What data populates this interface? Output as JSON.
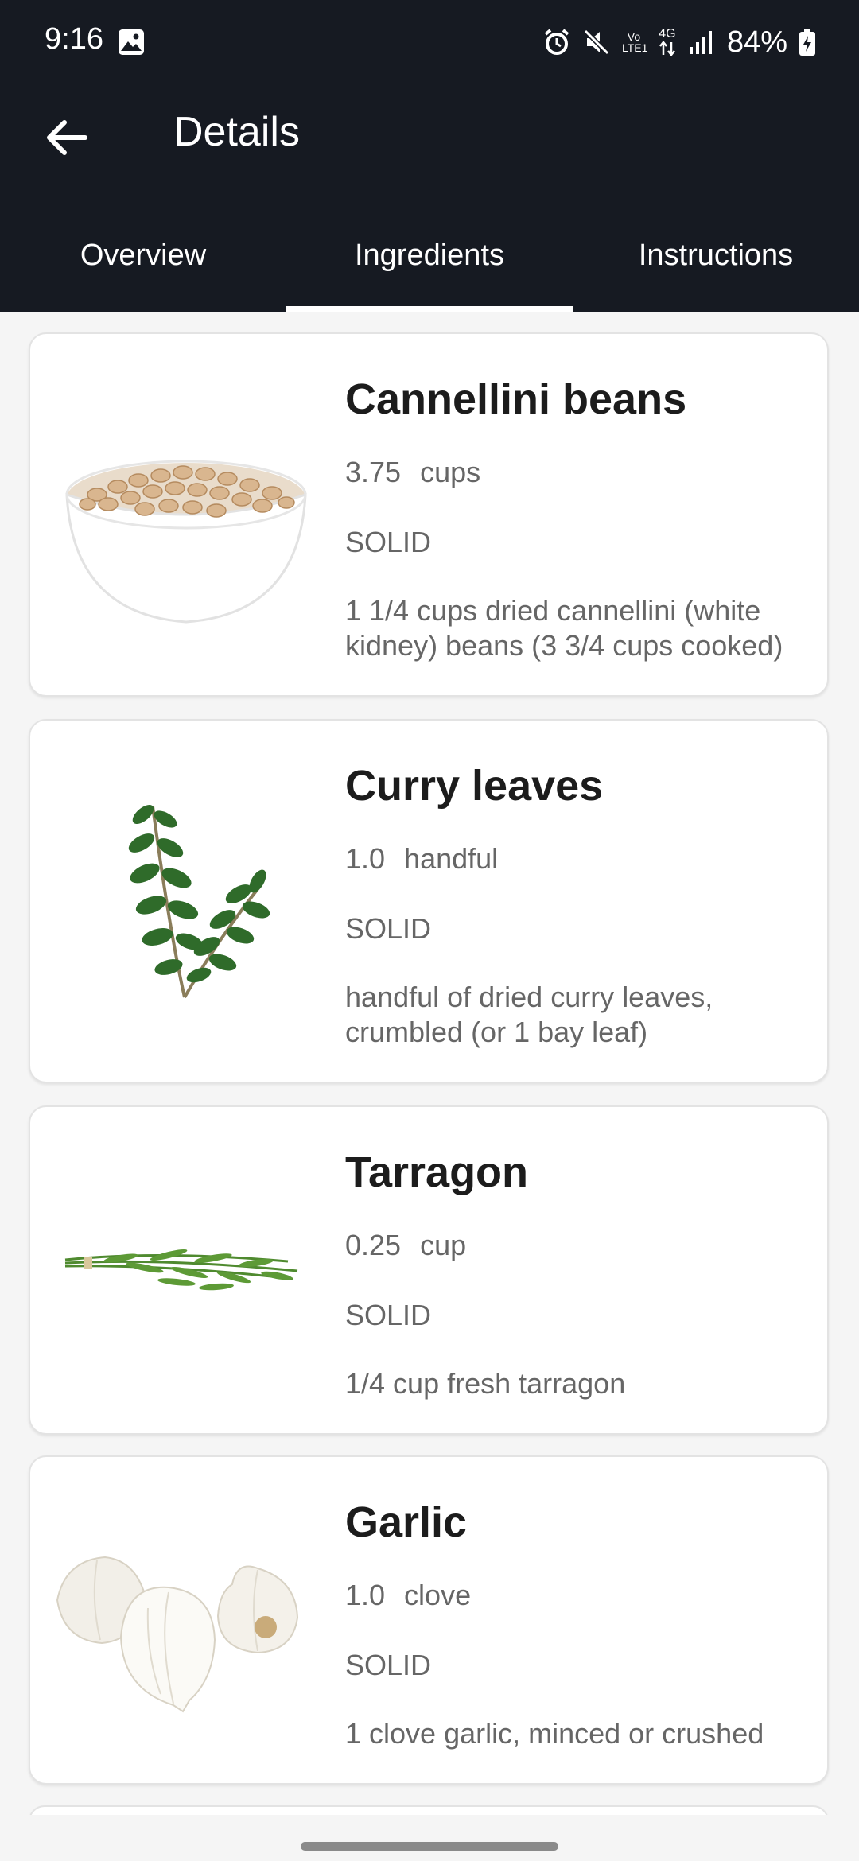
{
  "status_bar": {
    "time": "9:16",
    "battery": "84%",
    "network_label": "4G",
    "volte_label": "Vo LTE1",
    "icons": [
      "gallery-icon",
      "alarm-icon",
      "mute-icon",
      "volte-icon",
      "data-arrows-icon",
      "signal-icon",
      "battery-charging-icon"
    ]
  },
  "toolbar": {
    "back_icon": "arrow-left-icon",
    "title": "Details"
  },
  "tabs": [
    {
      "label": "Overview",
      "active": false
    },
    {
      "label": "Ingredients",
      "active": true
    },
    {
      "label": "Instructions",
      "active": false
    }
  ],
  "ingredients": [
    {
      "name": "Cannellini beans",
      "amount": "3.75",
      "unit": "cups",
      "type": "SOLID",
      "description": "1 1/4 cups dried cannellini (white kidney) beans (3 3/4 cups cooked)",
      "image": "bowl-of-beans-image"
    },
    {
      "name": "Curry leaves",
      "amount": "1.0",
      "unit": "handful",
      "type": "SOLID",
      "description": "handful of dried curry leaves, crumbled (or 1 bay leaf)",
      "image": "curry-leaves-image"
    },
    {
      "name": "Tarragon",
      "amount": "0.25",
      "unit": "cup",
      "type": "SOLID",
      "description": "1/4 cup fresh tarragon",
      "image": "tarragon-bunch-image"
    },
    {
      "name": "Garlic",
      "amount": "1.0",
      "unit": "clove",
      "type": "SOLID",
      "description": "1 clove garlic, minced or crushed",
      "image": "garlic-bulbs-image"
    }
  ],
  "colors": {
    "appbar_bg": "#161a22",
    "page_bg": "#f5f5f5",
    "card_bg": "#ffffff",
    "title_text": "#1c1c1c",
    "secondary_text": "#666666"
  }
}
